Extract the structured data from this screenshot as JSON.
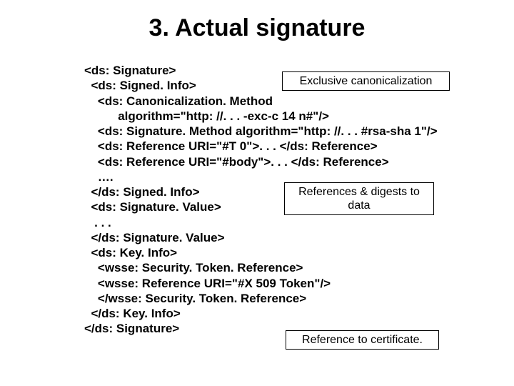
{
  "title": "3. Actual signature",
  "code": {
    "l1": "<ds: Signature>",
    "l2": "  <ds: Signed. Info>",
    "l3": "    <ds: Canonicalization. Method",
    "l4": "          algorithm=\"http: //. . . -exc-c 14 n#\"/>",
    "l5": "    <ds: Signature. Method algorithm=\"http: //. . . #rsa-sha 1\"/>",
    "l6": "    <ds: Reference URI=\"#T 0\">. . . </ds: Reference>",
    "l7": "    <ds: Reference URI=\"#body\">. . . </ds: Reference>",
    "l8": "    …. ",
    "l9": "  </ds: Signed. Info>",
    "l10": "  <ds: Signature. Value>",
    "l11": "   . . .",
    "l12": "  </ds: Signature. Value>",
    "l13": "  <ds: Key. Info>",
    "l14": "    <wsse: Security. Token. Reference>",
    "l15": "    <wsse: Reference URI=\"#X 509 Token\"/>",
    "l16": "    </wsse: Security. Token. Reference>",
    "l17": "  </ds: Key. Info>",
    "l18": "</ds: Signature>"
  },
  "callouts": {
    "c1": "Exclusive canonicalization",
    "c2": "References & digests to data",
    "c3": "Reference to certificate."
  }
}
